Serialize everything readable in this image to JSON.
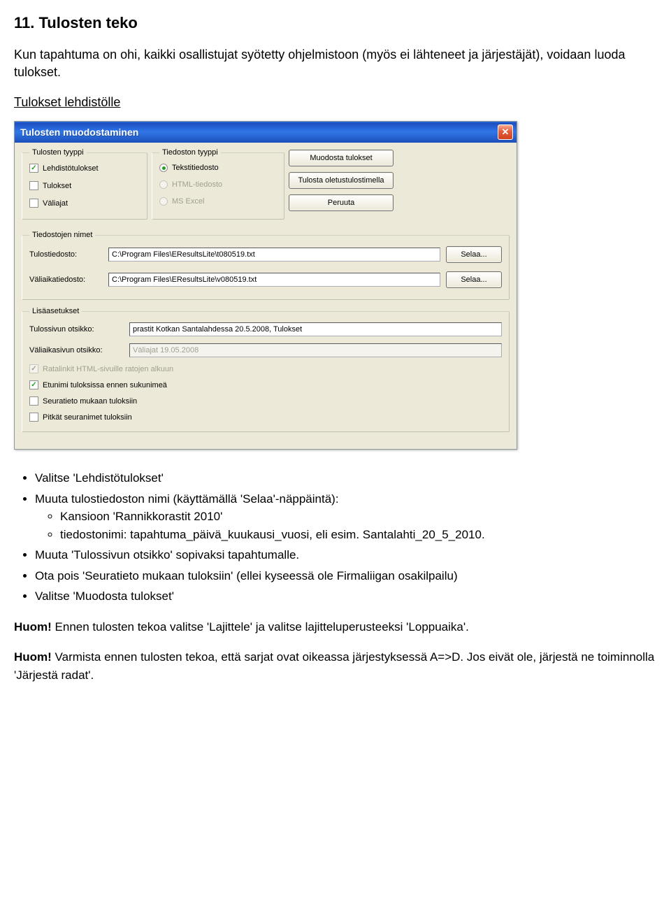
{
  "heading": "11. Tulosten teko",
  "intro": "Kun tapahtuma on ohi, kaikki osallistujat syötetty ohjelmistoon (myös ei lähteneet ja järjestäjät), voidaan luoda tulokset.",
  "subhead": "Tulokset lehdistölle",
  "dialog": {
    "title": "Tulosten muodostaminen",
    "group_results_type": {
      "legend": "Tulosten tyyppi",
      "lehdisto": "Lehdistötulokset",
      "tulokset": "Tulokset",
      "valiajat": "Väliajat"
    },
    "group_file_type": {
      "legend": "Tiedoston tyyppi",
      "teksti": "Tekstitiedosto",
      "html": "HTML-tiedosto",
      "excel": "MS Excel"
    },
    "buttons": {
      "make": "Muodosta tulokset",
      "print": "Tulosta oletustulostimella",
      "cancel": "Peruuta",
      "browse": "Selaa..."
    },
    "group_filenames": {
      "legend": "Tiedostojen nimet",
      "out_label": "Tulostiedosto:",
      "out_value": "C:\\Program Files\\EResultsLite\\t080519.txt",
      "split_label": "Väliaikatiedosto:",
      "split_value": "C:\\Program Files\\EResultsLite\\v080519.txt"
    },
    "group_additional": {
      "legend": "Lisäasetukset",
      "page_title_label": "Tulossivun otsikko:",
      "page_title_value": "prastit Kotkan Santalahdessa 20.5.2008, Tulokset",
      "split_title_label": "Väliaikasivun otsikko:",
      "split_title_value": "Väliajat 19.05.2008",
      "chk_ratalinkit": "Ratalinkit HTML-sivuille ratojen alkuun",
      "chk_etunimi": "Etunimi tuloksissa ennen sukunimeä",
      "chk_seuratieto": "Seuratieto mukaan tuloksiin",
      "chk_pitkat": "Pitkät seuranimet tuloksiin"
    }
  },
  "bullets": {
    "b1": "Valitse 'Lehdistötulokset'",
    "b2": "Muuta tulostiedoston nimi (käyttämällä 'Selaa'-näppäintä):",
    "b2a": "Kansioon 'Rannikkorastit 2010'",
    "b2b": "tiedostonimi: tapahtuma_päivä_kuukausi_vuosi, eli esim. Santalahti_20_5_2010.",
    "b3": "Muuta 'Tulossivun otsikko' sopivaksi tapahtumalle.",
    "b4": "Ota pois 'Seuratieto mukaan tuloksiin' (ellei kyseessä ole Firmaliigan osakilpailu)",
    "b5": "Valitse 'Muodosta tulokset'"
  },
  "notes": {
    "n1_bold": "Huom!",
    "n1_text": " Ennen tulosten tekoa valitse 'Lajittele' ja valitse lajitteluperusteeksi 'Loppuaika'.",
    "n2_bold": "Huom!",
    "n2_text": " Varmista ennen tulosten tekoa, että sarjat ovat oikeassa järjestyksessä A=>D. Jos eivät ole, järjestä ne toiminnolla 'Järjestä radat'."
  }
}
